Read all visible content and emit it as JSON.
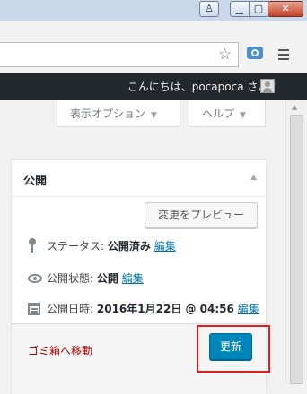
{
  "window": {
    "controls": {
      "user_glyph": "♙",
      "minimize_glyph": "▁",
      "maximize_glyph": "▢",
      "close_glyph": "✕"
    }
  },
  "browser": {
    "icons": [
      "star-icon",
      "camera-icon",
      "menu-icon"
    ]
  },
  "adminbar": {
    "greeting": "こんにちは、pocapoca さん !"
  },
  "tabs": {
    "screen_options": "表示オプション",
    "help": "ヘルプ",
    "arrow_glyph": "▼"
  },
  "publish": {
    "title": "公開",
    "collapse_glyph": "▲",
    "preview_button": "変更をプレビュー",
    "status": {
      "label": "ステータス:",
      "value": "公開済み",
      "edit": "編集"
    },
    "visibility": {
      "label": "公開状態:",
      "value": "公開",
      "edit": "編集"
    },
    "date": {
      "label": "公開日時:",
      "value": "2016年1月22日 @ 04:56",
      "edit": "編集"
    },
    "trash_link": "ゴミ箱へ移動",
    "update_button": "更新"
  },
  "colors": {
    "adminbar": "#23282d",
    "primary_button": "#0085ba",
    "link": "#0073aa",
    "trash": "#aa0000",
    "highlight": "#e01e1e"
  }
}
